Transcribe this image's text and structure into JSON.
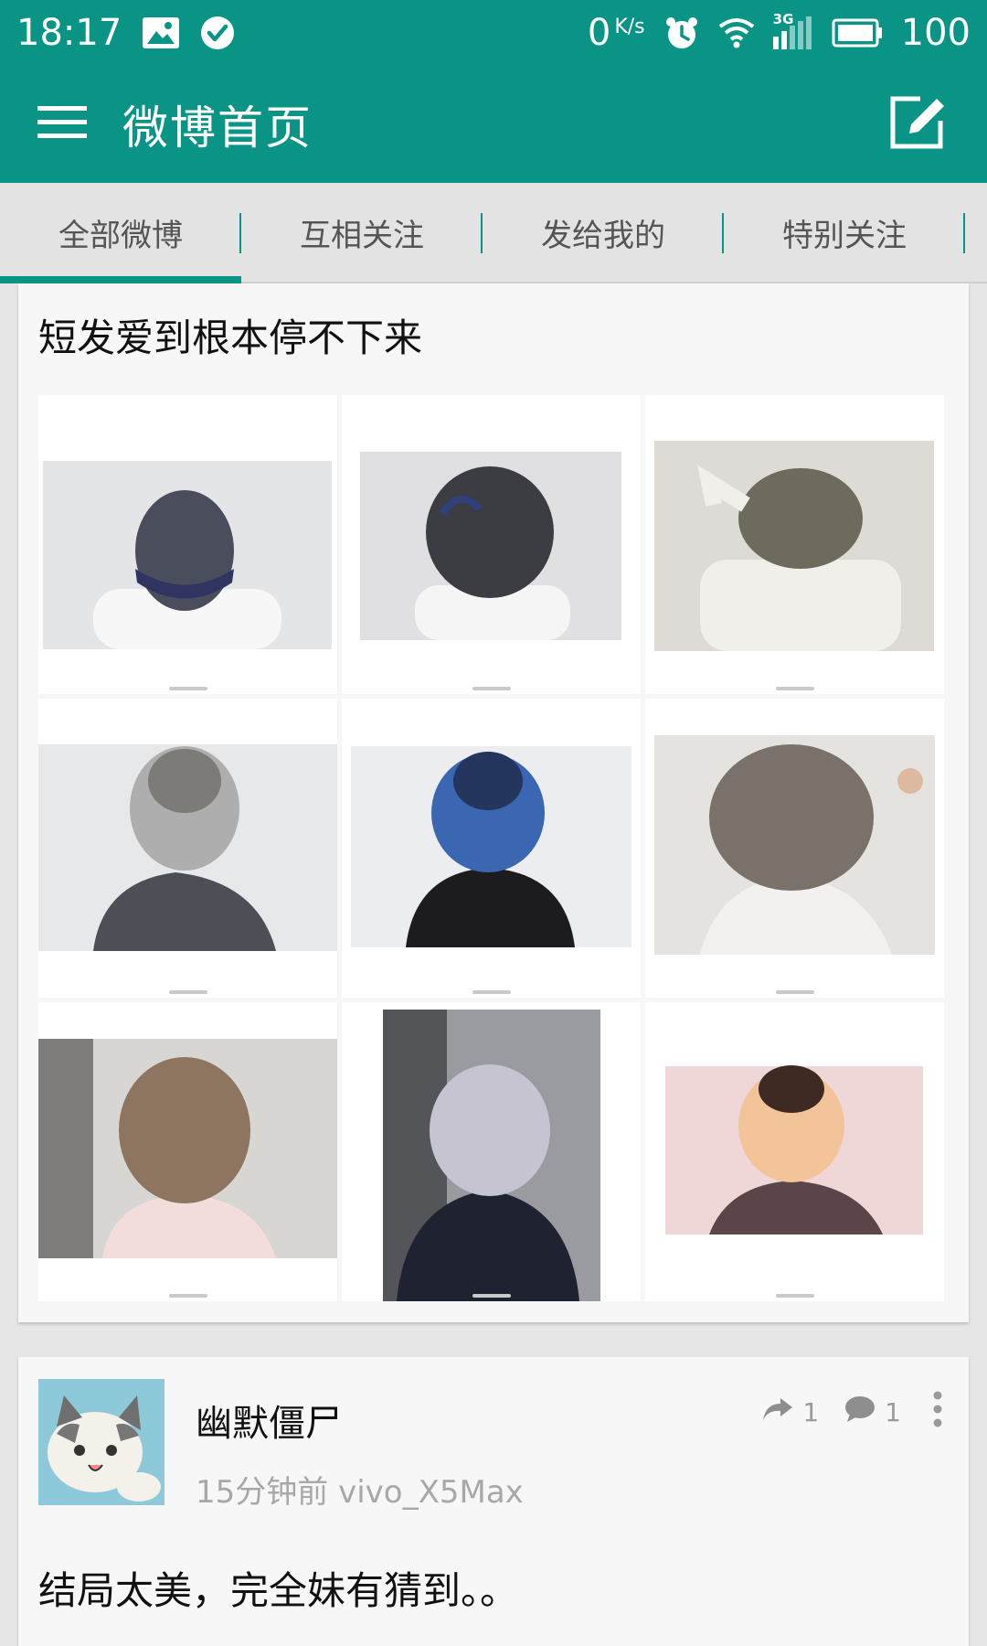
{
  "status_bar": {
    "time": "18:17",
    "speed": "0",
    "speed_unit": "K/s",
    "network": "3G",
    "battery": "100",
    "icons": [
      "image-icon",
      "check-circle-icon",
      "alarm-icon",
      "wifi-icon",
      "signal-icon",
      "battery-icon"
    ]
  },
  "app_bar": {
    "title": "微博首页",
    "icons": [
      "menu-icon",
      "compose-icon"
    ]
  },
  "tabs": [
    {
      "label": "全部微博",
      "active": true
    },
    {
      "label": "互相关注",
      "active": false
    },
    {
      "label": "发给我的",
      "active": false
    },
    {
      "label": "特别关注",
      "active": false
    }
  ],
  "posts": [
    {
      "text": "短发爱到根本停不下来",
      "images": [
        {
          "name": "short-hair-photo-1"
        },
        {
          "name": "short-hair-photo-2"
        },
        {
          "name": "short-hair-photo-3"
        },
        {
          "name": "short-hair-photo-4"
        },
        {
          "name": "short-hair-photo-5"
        },
        {
          "name": "short-hair-photo-6"
        },
        {
          "name": "short-hair-photo-7"
        },
        {
          "name": "short-hair-photo-8"
        },
        {
          "name": "short-hair-photo-9"
        }
      ]
    },
    {
      "username": "幽默僵尸",
      "time": "15分钟前",
      "source": "vivo_X5Max",
      "reposts": "1",
      "comments": "1",
      "text": "结局太美，完全妹有猜到。。",
      "avatar": "cartoon-cat-avatar"
    }
  ],
  "colors": {
    "primary": "#0a9486",
    "background": "#e6e6e6",
    "card": "#f7f7f7"
  }
}
